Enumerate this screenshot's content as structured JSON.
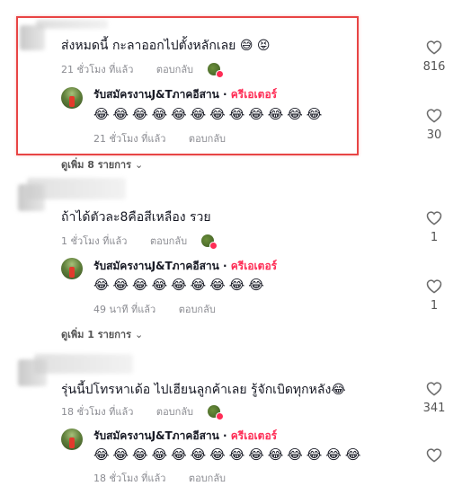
{
  "colors": {
    "highlight": "#e84545",
    "creator_accent": "#fe2c55",
    "meta_gray": "#8a8b91"
  },
  "icons": {
    "like": "heart-outline-icon",
    "expand": "chevron-down-icon"
  },
  "comments": [
    {
      "text": "ส่งหมดนี้ กะลาออกไปตั้งหลักเลย 😅 😝",
      "time": "21 ชั่วโมง ที่แล้ว",
      "reply_label": "ตอบกลับ",
      "likes": "816",
      "reply": {
        "name": "รับสมัครงานJ&Tภาคอีสาน",
        "separator": " · ",
        "badge": "ครีเอเตอร์",
        "emojis": "😂😂😂😂😂😂😂😂😂😂😂😂",
        "time": "21 ชั่วโมง ที่แล้ว",
        "reply_label": "ตอบกลับ",
        "likes": "30"
      },
      "more": "ดูเพิ่ม 8 รายการ"
    },
    {
      "text": "ถ้าได้ตัวละ8คือสีเหลือง รวย",
      "time": "1 ชั่วโมง ที่แล้ว",
      "reply_label": "ตอบกลับ",
      "likes": "1",
      "reply": {
        "name": "รับสมัครงานJ&Tภาคอีสาน",
        "separator": " · ",
        "badge": "ครีเอเตอร์",
        "emojis": "😂😂😂😂😂😂😂😂😂",
        "time": "49 นาที ที่แล้ว",
        "reply_label": "ตอบกลับ",
        "likes": "1"
      },
      "more": "ดูเพิ่ม 1 รายการ"
    },
    {
      "text": "รุ่นนี้ปโทรหาเด้อ ไปเฮียนลูกค้าเลย รู้จักเบิดทุกหลัง😂",
      "time": "18 ชั่วโมง ที่แล้ว",
      "reply_label": "ตอบกลับ",
      "likes": "341",
      "reply": {
        "name": "รับสมัครงานJ&Tภาคอีสาน",
        "separator": " · ",
        "badge": "ครีเอเตอร์",
        "emojis": "😂😂😂😂😂😂😂😂😂😂😂😂😂😂",
        "time": "18 ชั่วโมง ที่แล้ว",
        "reply_label": "ตอบกลับ",
        "likes": ""
      }
    }
  ]
}
